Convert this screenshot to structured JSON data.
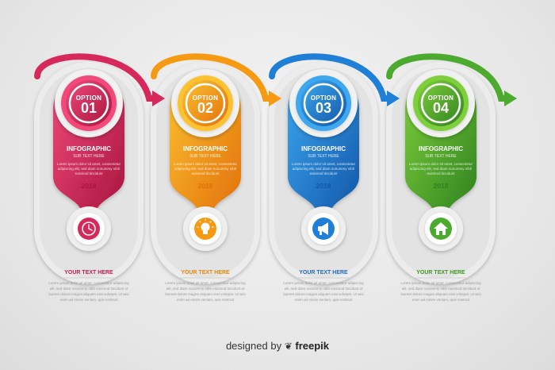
{
  "options": [
    {
      "label": "OPTION",
      "number": "01",
      "title": "INFOGRAPHIC",
      "subtitle": "SUB TEXT HERE",
      "lorem": "Lorem ipsum dolor sit amet, consectetur adipiscing elit, sed diam nonummy nibh euismod tincidunt",
      "year": "2018",
      "icon": "clock-icon",
      "heading": "YOUR TEXT HERE",
      "body": "Lorem ipsum dolor sit amet, consectetur adipiscing elit, sed diam nonummy nibh euismod tincidunt ut laoreet dolore magna aliquam erat volutpat. Ut wisi enim ad minim veniam, quis nostrud",
      "color": "#d6285b",
      "color_light": "#f04a7a",
      "color_dark": "#a8163f",
      "heading_color": "#c4214f"
    },
    {
      "label": "OPTION",
      "number": "02",
      "title": "INFOGRAPHIC",
      "subtitle": "SUB TEXT HERE",
      "lorem": "Lorem ipsum dolor sit amet, consectetur adipiscing elit, sed diam nonummy nibh euismod tincidunt",
      "year": "2018",
      "icon": "lightbulb-icon",
      "heading": "YOUR TEXT HERE",
      "body": "Lorem ipsum dolor sit amet, consectetur adipiscing elit, sed diam nonummy nibh euismod tincidunt ut laoreet dolore magna aliquam erat volutpat. Ut wisi enim ad minim veniam, quis nostrud",
      "color": "#f59a12",
      "color_light": "#fcc233",
      "color_dark": "#e2700a",
      "heading_color": "#e88a0c"
    },
    {
      "label": "OPTION",
      "number": "03",
      "title": "INFOGRAPHIC",
      "subtitle": "SUB TEXT HERE",
      "lorem": "Lorem ipsum dolor sit amet, consectetur adipiscing elit, sed diam nonummy nibh euismod tincidunt",
      "year": "2018",
      "icon": "megaphone-icon",
      "heading": "YOUR TEXT HERE",
      "body": "Lorem ipsum dolor sit amet, consectetur adipiscing elit, sed diam nonummy nibh euismod tincidunt ut laoreet dolore magna aliquam erat volutpat. Ut wisi enim ad minim veniam, quis nostrud",
      "color": "#1f7fd6",
      "color_light": "#3ea8f0",
      "color_dark": "#1257a8",
      "heading_color": "#1f6fc0"
    },
    {
      "label": "OPTION",
      "number": "04",
      "title": "INFOGRAPHIC",
      "subtitle": "SUB TEXT HERE",
      "lorem": "Lorem ipsum dolor sit amet, consectetur adipiscing elit, sed diam nonummy nibh euismod tincidunt",
      "year": "2018",
      "icon": "home-icon",
      "heading": "YOUR TEXT HERE",
      "body": "Lorem ipsum dolor sit amet, consectetur adipiscing elit, sed diam nonummy nibh euismod tincidunt ut laoreet dolore magna aliquam erat volutpat. Ut wisi enim ad minim veniam, quis nostrud",
      "color": "#4caa2e",
      "color_light": "#7fcf3c",
      "color_dark": "#2f8220",
      "heading_color": "#3f9a24"
    }
  ],
  "credit": {
    "prefix": "designed by",
    "brand": "freepik"
  }
}
